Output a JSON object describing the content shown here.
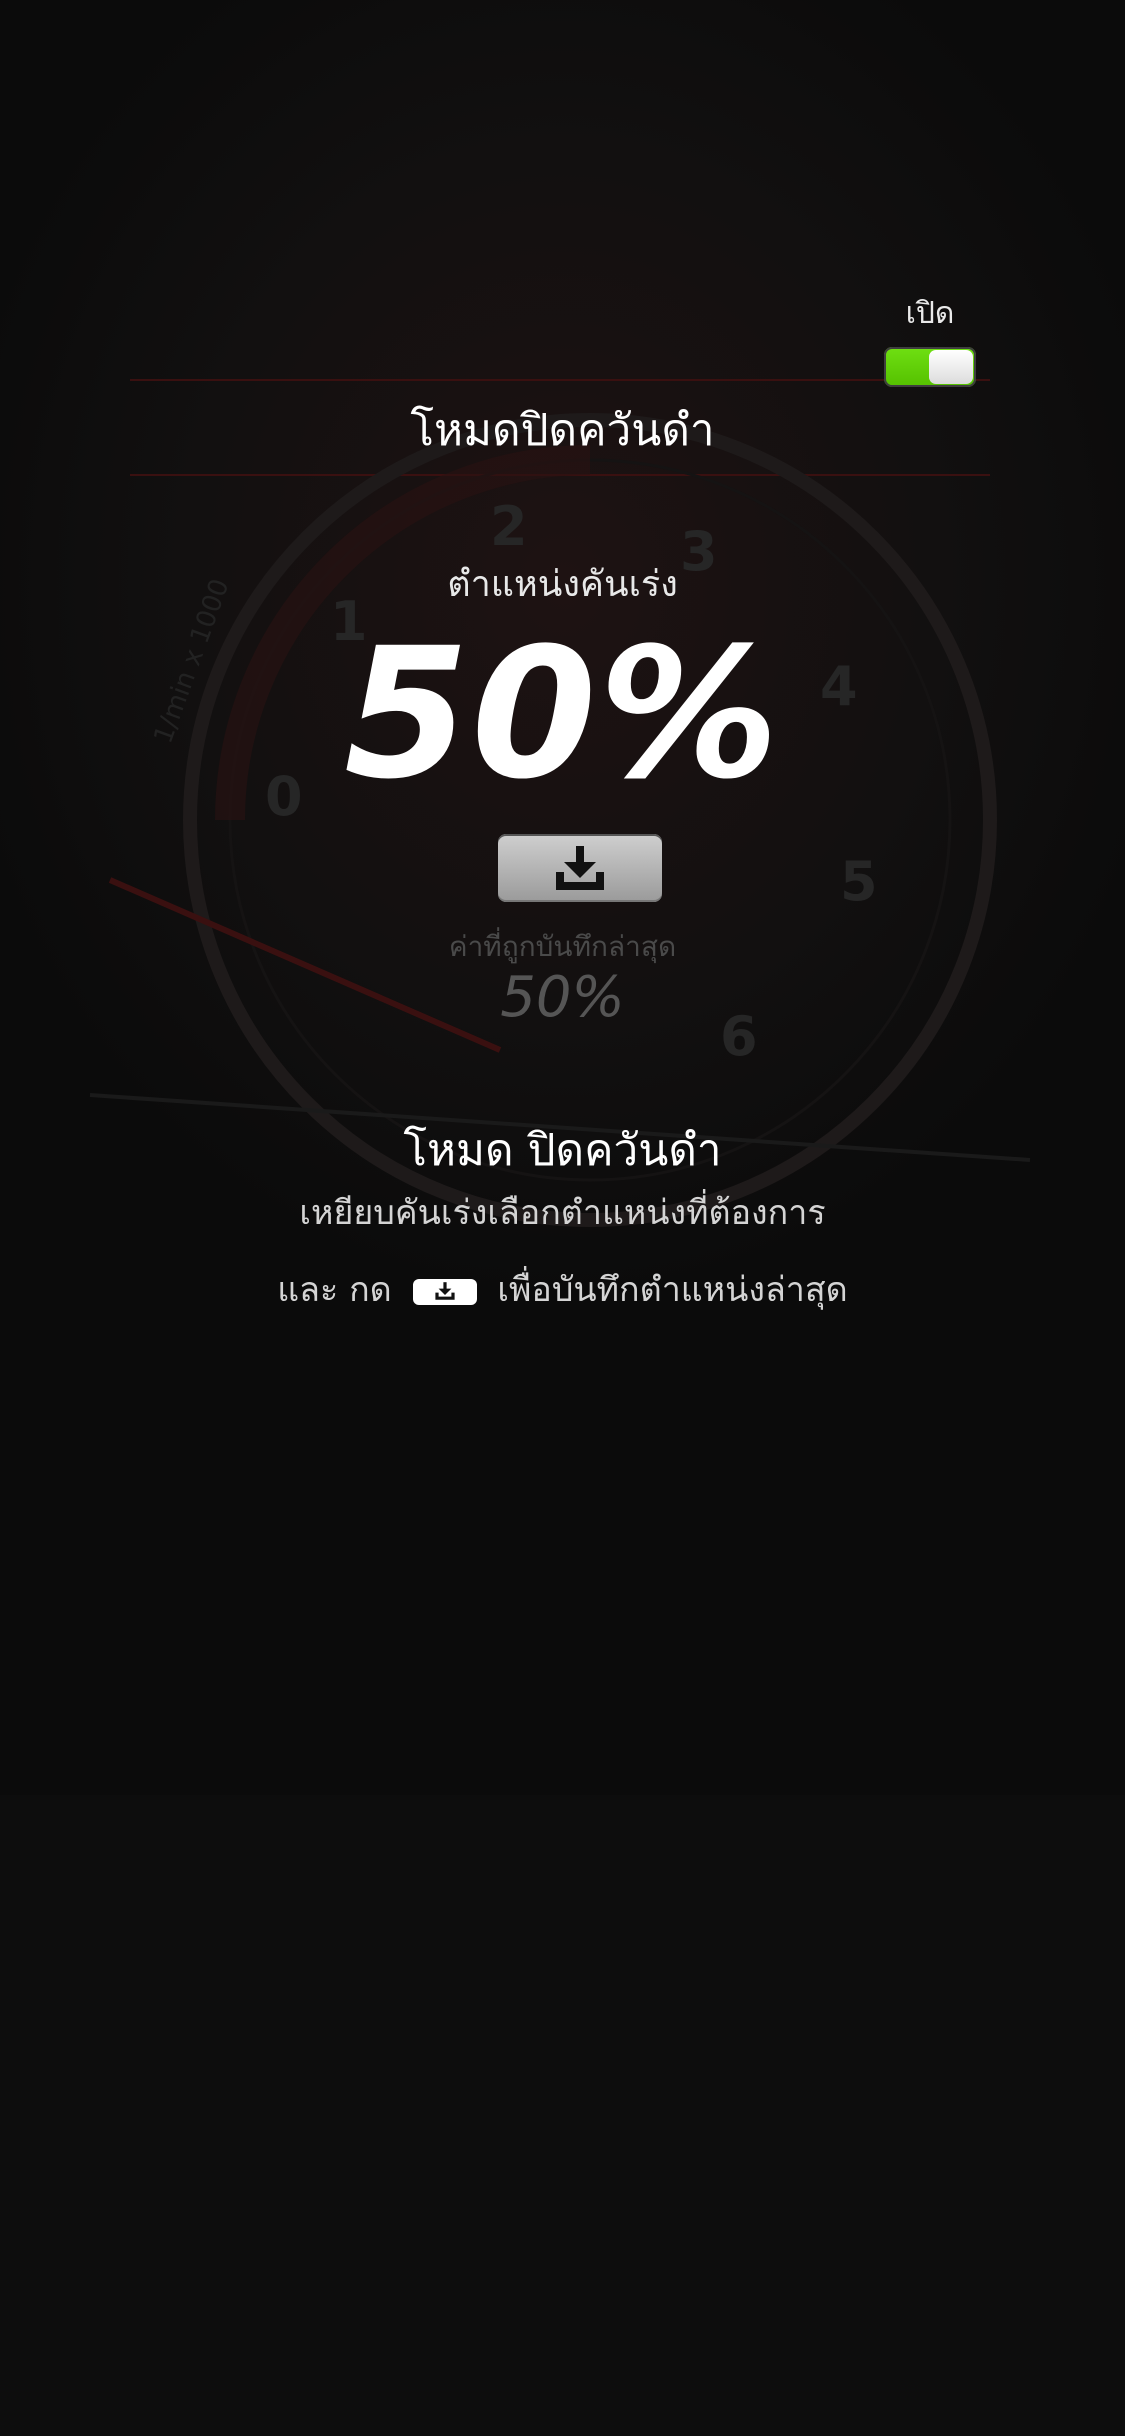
{
  "toggle": {
    "label": "เปิด",
    "on": true,
    "accent": "#6fe012"
  },
  "mode_title": "โหมดปิดควันดำ",
  "throttle": {
    "label": "ตำแหน่งคันเร่ง",
    "value": "50%"
  },
  "save_button": {
    "icon": "download-icon"
  },
  "last_saved": {
    "label": "ค่าที่ถูกบันทึกล่าสุด",
    "value": "50%"
  },
  "info": {
    "title": "โหมด ปิดควันดำ",
    "line1": "เหยียบคันเร่งเลือกตำแหน่งที่ต้องการ",
    "line2_prefix": "และ กด",
    "line2_suffix": "เพื่อบันทึกตำแหน่งล่าสุด",
    "inline_icon": "download-icon"
  },
  "gauge_background": {
    "tick_labels": [
      "0",
      "1",
      "2",
      "3",
      "4",
      "5",
      "6"
    ],
    "unit_label": "1/min x 1000"
  }
}
